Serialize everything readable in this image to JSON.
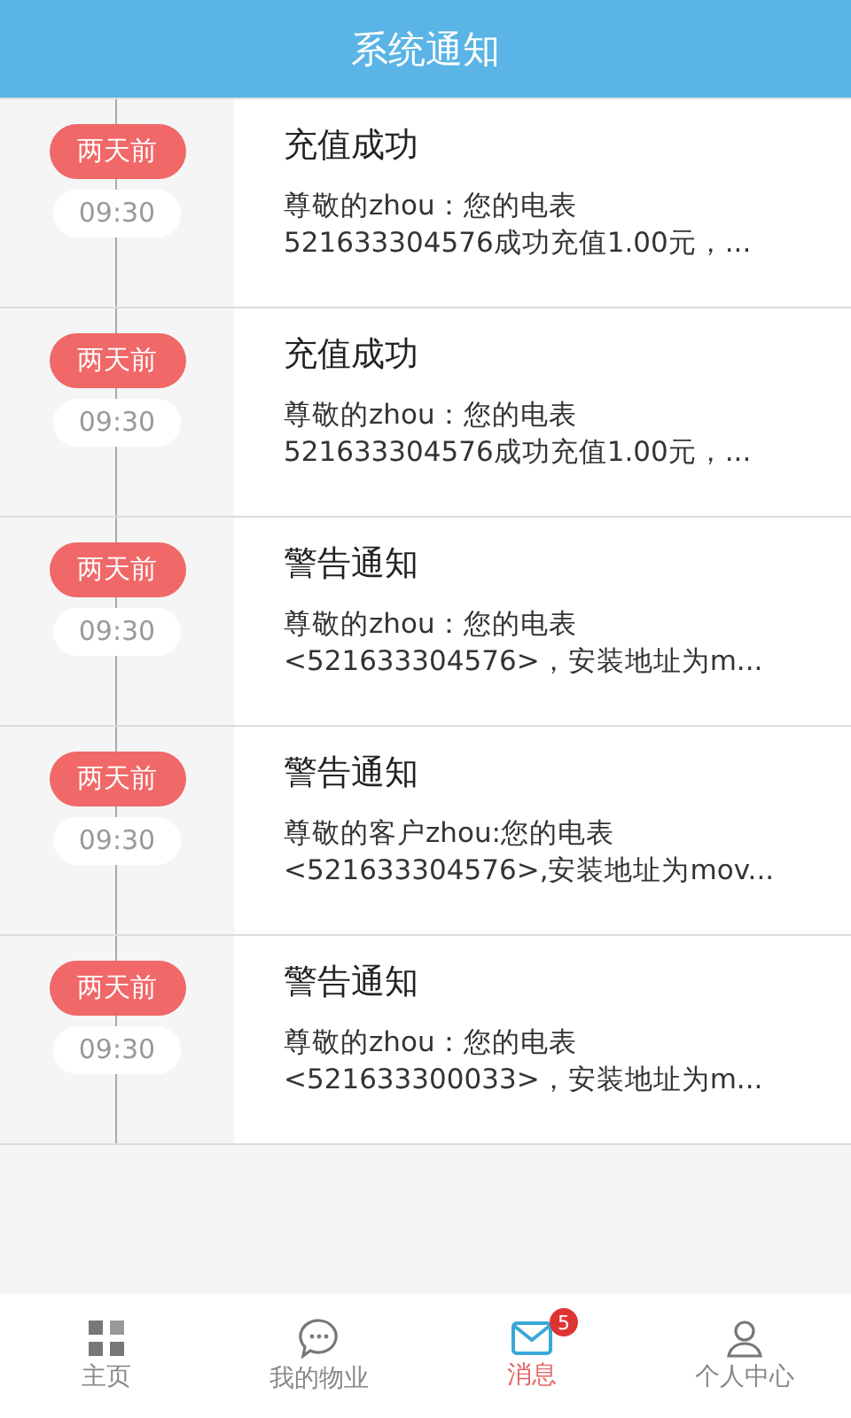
{
  "header": {
    "title": "系统通知"
  },
  "messages": [
    {
      "day": "两天前",
      "time": "09:30",
      "title": "充值成功",
      "body_lines": [
        "尊敬的zhou：您的电表",
        "521633304576成功充值1.00元，..."
      ]
    },
    {
      "day": "两天前",
      "time": "09:30",
      "title": "充值成功",
      "body_lines": [
        "尊敬的zhou：您的电表",
        "521633304576成功充值1.00元，..."
      ]
    },
    {
      "day": "两天前",
      "time": "09:30",
      "title": "警告通知",
      "body_lines": [
        "尊敬的zhou：您的电表",
        "<521633304576>，安装地址为m..."
      ]
    },
    {
      "day": "两天前",
      "time": "09:30",
      "title": "警告通知",
      "body_lines": [
        "尊敬的客户zhou:您的电表",
        "<521633304576>,安装地址为mov..."
      ]
    },
    {
      "day": "两天前",
      "time": "09:30",
      "title": "警告通知",
      "body_lines": [
        "尊敬的zhou：您的电表",
        "<521633300033>，安装地址为m..."
      ]
    }
  ],
  "tabs": [
    {
      "kind": "home",
      "label": "主页",
      "selected": false
    },
    {
      "kind": "chat",
      "label": "我的物业",
      "selected": false
    },
    {
      "kind": "mail",
      "label": "消息",
      "selected": true,
      "badge": "5"
    },
    {
      "kind": "person",
      "label": "个人中心",
      "selected": false
    }
  ]
}
